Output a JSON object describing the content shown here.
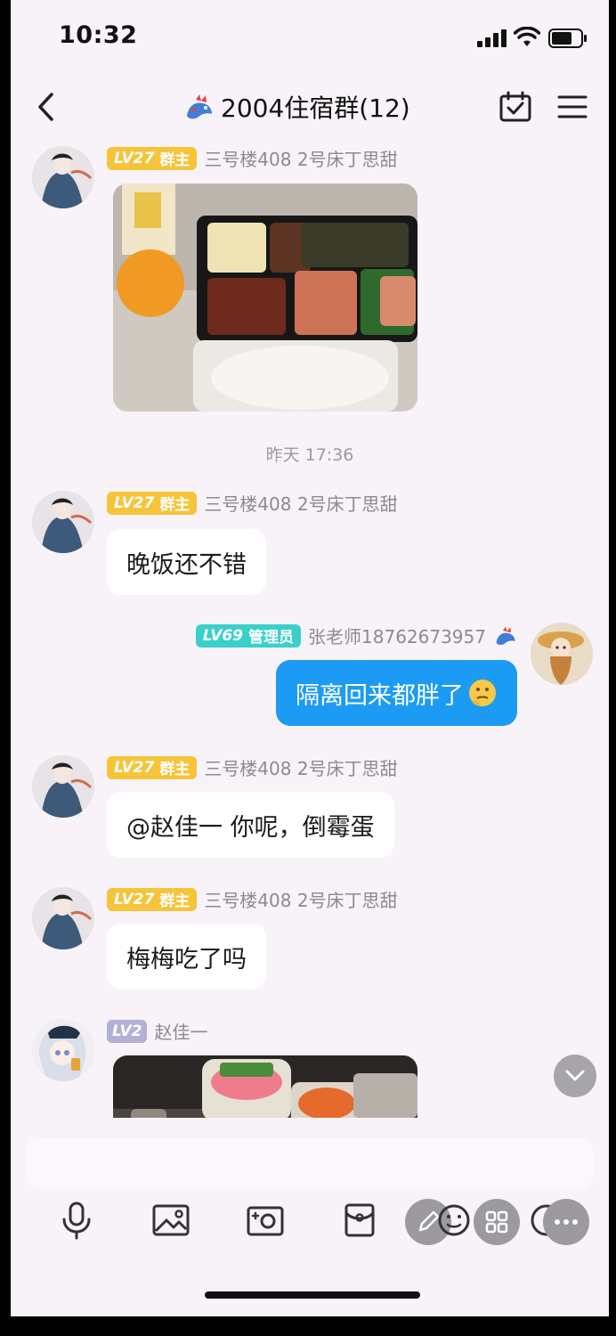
{
  "status_bar": {
    "time": "10:32"
  },
  "header": {
    "title": "2004住宿群(12)",
    "title_icon": "dragon-emoji-icon"
  },
  "messages": [
    {
      "type": "image",
      "badge": {
        "level": "LV27",
        "role": "群主",
        "color": "#f6c43a"
      },
      "nick": "三号楼408 2号床丁思甜",
      "image_desc": "food-photo"
    },
    {
      "type": "timestamp",
      "text": "昨天 17:36"
    },
    {
      "type": "text",
      "badge": {
        "level": "LV27",
        "role": "群主"
      },
      "nick": "三号楼408 2号床丁思甜",
      "text": "晚饭还不错"
    },
    {
      "type": "text-self",
      "badge": {
        "level": "LV69",
        "role": "管理员",
        "color": "#3ad0c9"
      },
      "nick": "张老师18762673957",
      "text": "隔离回来都胖了",
      "emoji": "thinking-emoji-icon"
    },
    {
      "type": "text",
      "badge": {
        "level": "LV27",
        "role": "群主"
      },
      "nick": "三号楼408 2号床丁思甜",
      "text": "@赵佳一 你呢，倒霉蛋"
    },
    {
      "type": "text",
      "badge": {
        "level": "LV27",
        "role": "群主"
      },
      "nick": "三号楼408 2号床丁思甜",
      "text": "梅梅吃了吗"
    },
    {
      "type": "image",
      "badge": {
        "level": "LV2",
        "role": "",
        "color": "#b3b0d8"
      },
      "nick": "赵佳一",
      "image_desc": "snacks-photo"
    }
  ],
  "colors": {
    "accent": "#1c9bf4",
    "background": "#f8f3f8"
  }
}
